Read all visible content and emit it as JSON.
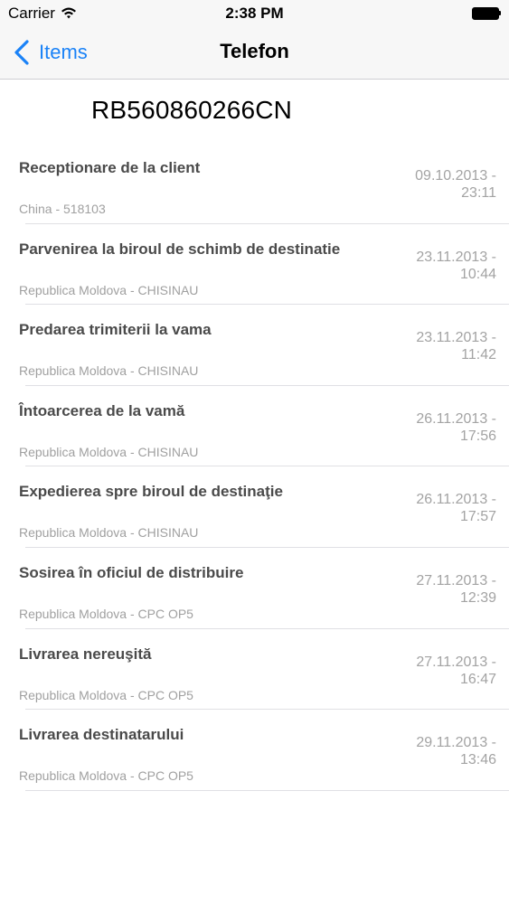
{
  "status_bar": {
    "carrier": "Carrier",
    "time": "2:38 PM"
  },
  "nav": {
    "back_label": "Items",
    "title": "Telefon"
  },
  "tracking_number": "RB560860266CN",
  "events": [
    {
      "title": "Receptionare de la client",
      "location": "China - 518103",
      "date_line1": "09.10.2013 -",
      "date_line2": "23:11"
    },
    {
      "title": "Parvenirea la biroul de schimb de destinatie",
      "location": "Republica Moldova - CHISINAU",
      "date_line1": "23.11.2013 -",
      "date_line2": "10:44"
    },
    {
      "title": "Predarea trimiterii la vama",
      "location": "Republica Moldova - CHISINAU",
      "date_line1": "23.11.2013 -",
      "date_line2": "11:42"
    },
    {
      "title": "Întoarcerea de la vamă",
      "location": "Republica Moldova - CHISINAU",
      "date_line1": "26.11.2013 -",
      "date_line2": "17:56"
    },
    {
      "title": "Expedierea spre biroul de destinaţie",
      "location": "Republica Moldova - CHISINAU",
      "date_line1": "26.11.2013 -",
      "date_line2": "17:57"
    },
    {
      "title": "Sosirea în oficiul de distribuire",
      "location": "Republica Moldova - CPC OP5",
      "date_line1": "27.11.2013 -",
      "date_line2": "12:39"
    },
    {
      "title": "Livrarea nereuşită",
      "location": "Republica Moldova - CPC OP5",
      "date_line1": "27.11.2013 -",
      "date_line2": "16:47"
    },
    {
      "title": "Livrarea destinatarului",
      "location": "Republica Moldova - CPC OP5",
      "date_line1": "29.11.2013 -",
      "date_line2": "13:46"
    }
  ],
  "colors": {
    "accent": "#1a82f7",
    "title_text": "#4a4a4a",
    "secondary_text": "#a0a0a0",
    "bar_background": "#f7f7f7"
  }
}
